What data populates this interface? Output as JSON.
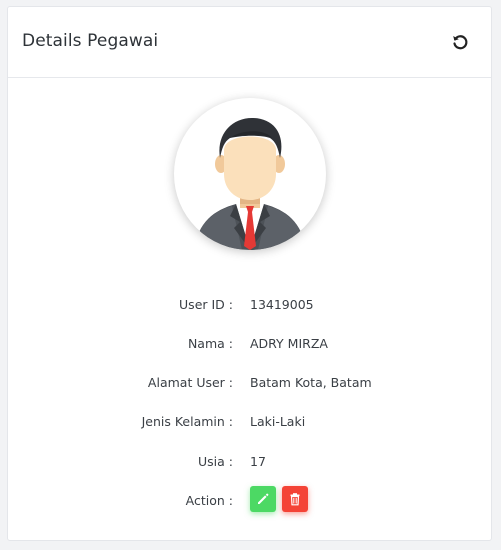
{
  "card": {
    "title": "Details Pegawai",
    "refresh_icon": "refresh-icon"
  },
  "avatar": {
    "icon": "male-user-avatar"
  },
  "details": [
    {
      "label": "User ID :",
      "value": "13419005"
    },
    {
      "label": "Nama :",
      "value": "ADRY MIRZA"
    },
    {
      "label": "Alamat User :",
      "value": "Batam Kota, Batam"
    },
    {
      "label": "Jenis Kelamin :",
      "value": "Laki-Laki"
    },
    {
      "label": "Usia :",
      "value": "17"
    }
  ],
  "action": {
    "label": "Action :",
    "edit_icon": "pencil-icon",
    "delete_icon": "trash-icon",
    "edit_color": "#4cd964",
    "delete_color": "#f44336"
  }
}
